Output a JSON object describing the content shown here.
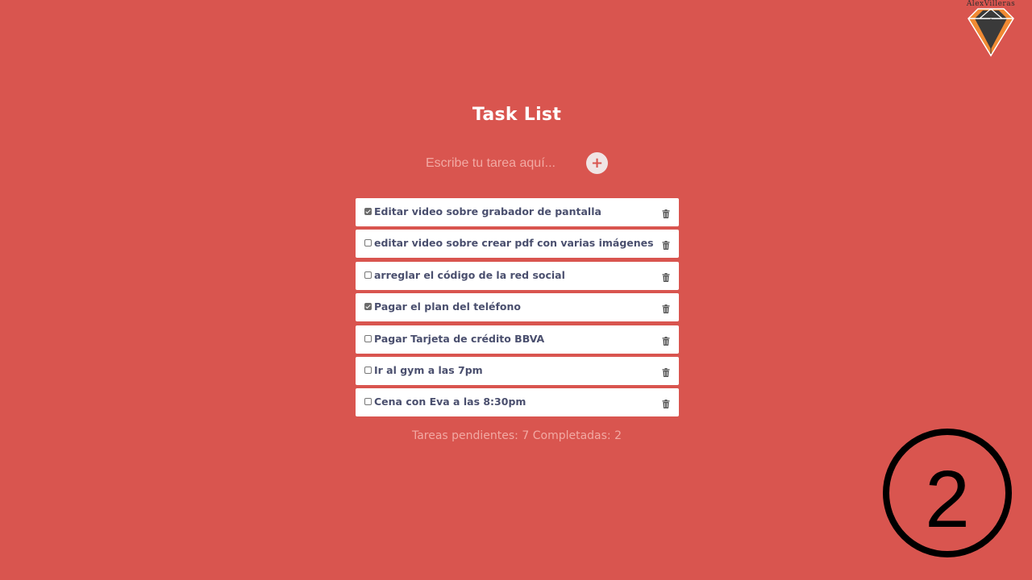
{
  "brand": {
    "logo_text": "AlexVilleras",
    "logo_colors": {
      "dark": "#3a3a3a",
      "accent": "#f08a33",
      "outline": "#ffffff"
    }
  },
  "header": {
    "title": "Task List"
  },
  "new_task": {
    "value": "",
    "placeholder": "Escribe tu tarea aquí...",
    "add_label": "+"
  },
  "tasks": [
    {
      "text": "Editar video sobre grabador de pantalla",
      "completed": true
    },
    {
      "text": "editar video sobre crear pdf con varias imágenes",
      "completed": false
    },
    {
      "text": "arreglar el código de la red social",
      "completed": false
    },
    {
      "text": "Pagar el plan del teléfono",
      "completed": true
    },
    {
      "text": "Pagar Tarjeta de crédito BBVA",
      "completed": false
    },
    {
      "text": "Ir al gym a las 7pm",
      "completed": false
    },
    {
      "text": "Cena con Eva a las 8:30pm",
      "completed": false
    }
  ],
  "status": {
    "pending_label": "Tareas pendientes:",
    "pending_count": "7",
    "completed_label": "Completadas:",
    "completed_count": "2"
  },
  "overlay": {
    "step_number": "2"
  },
  "colors": {
    "background": "#d9554f",
    "task_text": "#4a4f6e",
    "muted_text": "#f2a9a3",
    "card": "#ffffff"
  },
  "icons": {
    "delete": "trash-icon",
    "add": "plus-icon",
    "logo": "diamond-logo-icon"
  }
}
